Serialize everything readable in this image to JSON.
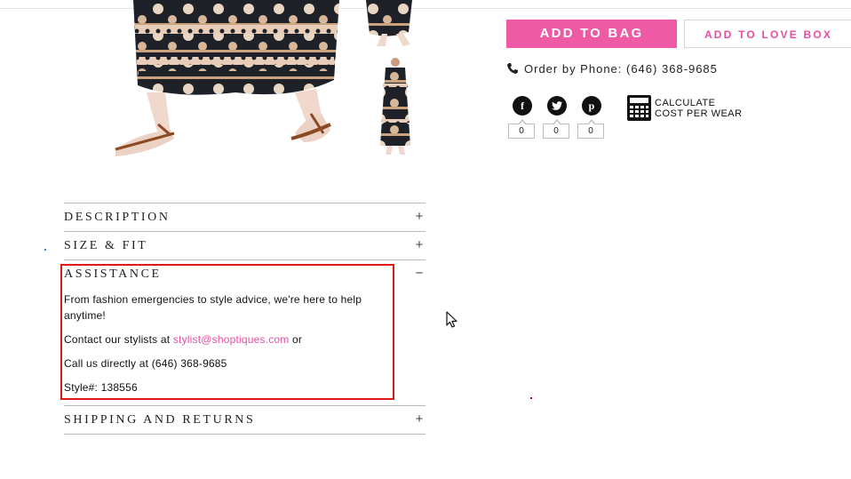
{
  "actions": {
    "add_to_bag": "ADD TO BAG",
    "add_to_love_box": "ADD TO LOVE BOX"
  },
  "order_phone": "Order by Phone: (646) 368-9685",
  "social": {
    "facebook_count": "0",
    "twitter_count": "0",
    "pinterest_count": "0",
    "facebook_glyph": "f",
    "pinterest_glyph": "p"
  },
  "calculator": {
    "line1": "CALCULATE",
    "line2": "COST PER WEAR"
  },
  "accordion": {
    "description": {
      "title": "DESCRIPTION",
      "toggle": "+"
    },
    "size_fit": {
      "title": "SIZE & FIT",
      "toggle": "+"
    },
    "assistance": {
      "title": "ASSISTANCE",
      "toggle": "−",
      "intro": "From fashion emergencies to style advice, we're here to help anytime!",
      "contact_prefix": "Contact our stylists at ",
      "email": "stylist@shoptiques.com",
      "contact_suffix": " or",
      "call_line": "Call us directly at (646) 368-9685",
      "style_line": "Style#: 138556"
    },
    "shipping": {
      "title": "SHIPPING AND RETURNS",
      "toggle": "+"
    }
  },
  "colors": {
    "accent_pink": "#ee5aa4",
    "link_pink": "#e64fa0",
    "highlight_red": "#e01818"
  }
}
